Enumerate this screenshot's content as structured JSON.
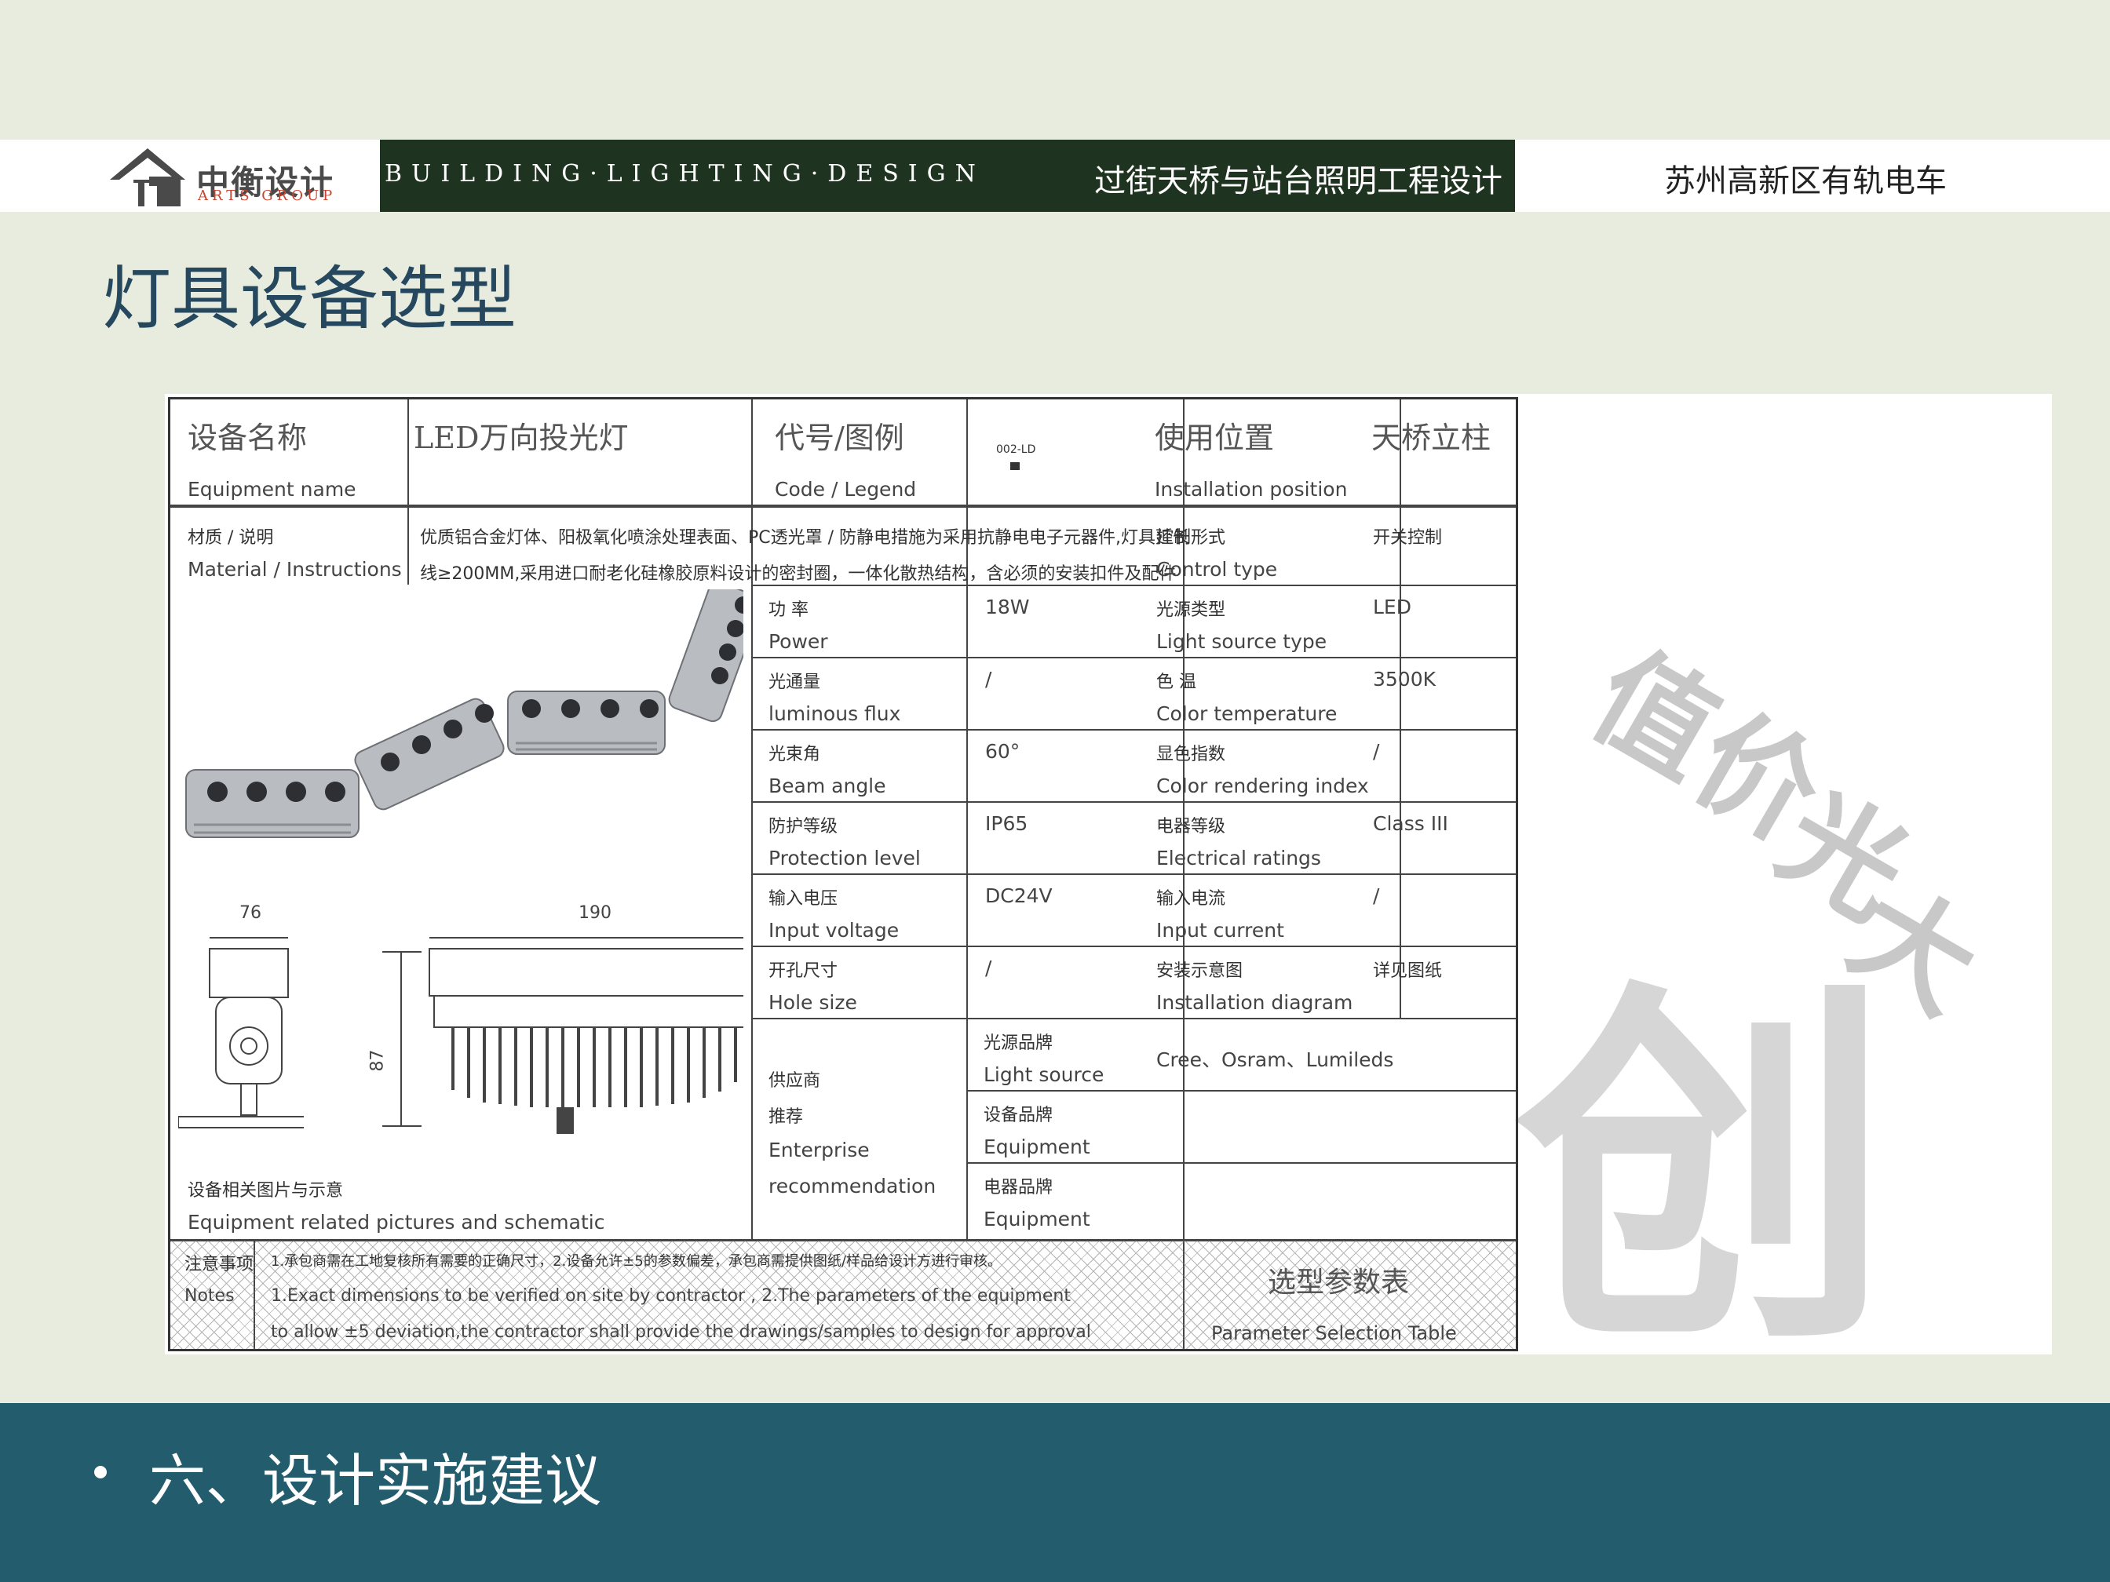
{
  "header": {
    "logo_cn": "中衡设计",
    "logo_en": "ARTS GROUP",
    "banner_en": "BUILDING·LIGHTING·DESIGN",
    "banner_cn": "过街天桥与站台照明工程设计",
    "project": "苏州高新区有轨电车"
  },
  "page_title": "灯具设备选型",
  "sheet": {
    "equipment_name_cn": "设备名称",
    "equipment_name_en": "Equipment name",
    "equipment_name_value": "LED万向投光灯",
    "code_cn": "代号/图例",
    "code_en": "Code / Legend",
    "code_value": "002-LD",
    "position_cn": "使用位置",
    "position_en": "Installation position",
    "position_value": "天桥立柱",
    "material_cn": "材质 / 说明",
    "material_en": "Material / Instructions",
    "material_line1": "优质铝合金灯体、阳极氧化喷涂处理表面、PC透光罩 / 防静电措施为采用抗静电电子元器件,灯具延长",
    "material_line2": "线≥200MM,采用进口耐老化硅橡胶原料设计的密封圈，一体化散热结构，含必须的安装扣件及配件",
    "control_cn": "控制形式",
    "control_en": "Control type",
    "control_value": "开关控制",
    "params": [
      {
        "l_cn": "功  率",
        "l_en": "Power",
        "l_val": "18W",
        "r_cn": "光源类型",
        "r_en": "Light source type",
        "r_val": "LED"
      },
      {
        "l_cn": "光通量",
        "l_en": "luminous flux",
        "l_val": "/",
        "r_cn": "色  温",
        "r_en": "Color temperature",
        "r_val": "3500K"
      },
      {
        "l_cn": "光束角",
        "l_en": "Beam angle",
        "l_val": "60°",
        "r_cn": "显色指数",
        "r_en": "Color rendering index",
        "r_val": "/"
      },
      {
        "l_cn": "防护等级",
        "l_en": "Protection level",
        "l_val": "IP65",
        "r_cn": "电器等级",
        "r_en": "Electrical ratings",
        "r_val": "Class III"
      },
      {
        "l_cn": "输入电压",
        "l_en": "Input voltage",
        "l_val": "DC24V",
        "r_cn": "输入电流",
        "r_en": "Input current",
        "r_val": "/"
      },
      {
        "l_cn": "开孔尺寸",
        "l_en": "Hole size",
        "l_val": "/",
        "r_cn": "安装示意图",
        "r_en": "Installation diagram",
        "r_val": "详见图纸"
      }
    ],
    "supplier_cn": "供应商",
    "supplier_cn2": "推荐",
    "supplier_en1": "Enterprise",
    "supplier_en2": "recommendation",
    "brands": [
      {
        "cn": "光源品牌",
        "en": "Light source",
        "value": "Cree、Osram、Lumileds"
      },
      {
        "cn": "设备品牌",
        "en": "Equipment",
        "value": ""
      },
      {
        "cn": "电器品牌",
        "en": "Equipment",
        "value": ""
      }
    ],
    "dims": {
      "d76": "76",
      "d190": "190",
      "d87": "87"
    },
    "pictures_cn": "设备相关图片与示意",
    "pictures_en": "Equipment related pictures and schematic",
    "notes_cn": "注意事项",
    "notes_en": "Notes",
    "notes_line1": "1.承包商需在工地复核所有需要的正确尺寸，2.设备允许±5的参数偏差，承包商需提供图纸/样品给设计方进行审核。",
    "notes_line2": "1.Exact dimensions to be verified on site by contractor , 2.The parameters of the equipment",
    "notes_line3": "to allow ±5 deviation,the contractor shall provide the drawings/samples to design for approval",
    "table_cn": "选型参数表",
    "table_en": "Parameter Selection Table"
  },
  "watermark": {
    "chars": [
      "值",
      "价",
      "光",
      "大",
      "创"
    ]
  },
  "footer": {
    "bullet_text": "六、设计实施建议"
  },
  "colors": {
    "background": "#e8ecdf",
    "title": "#26485f",
    "footer": "#235c6c",
    "banner": "#1f3420"
  }
}
